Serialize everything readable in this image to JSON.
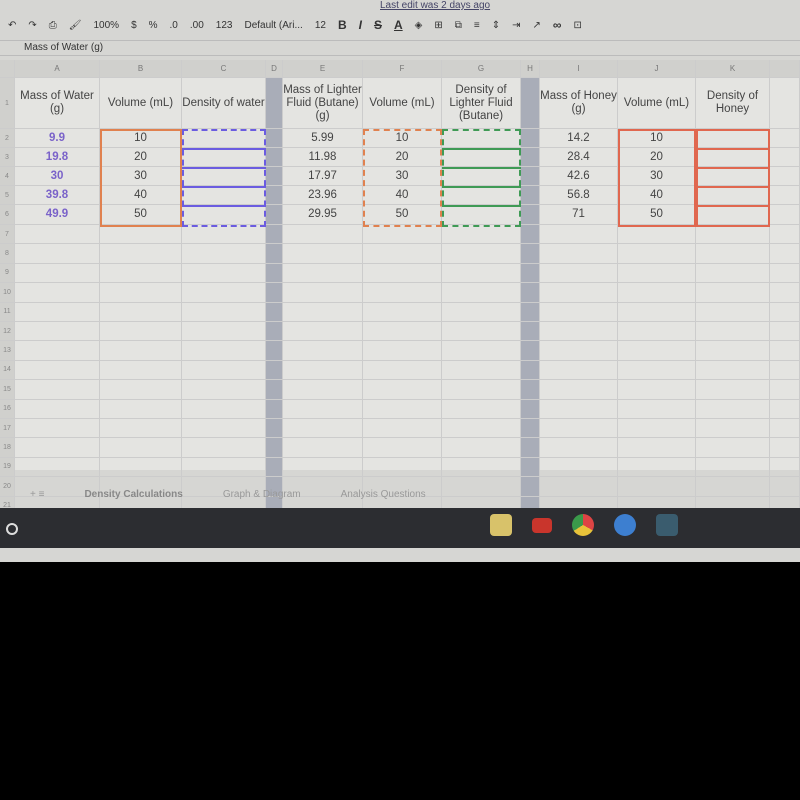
{
  "top_link": "Last edit was 2 days ago",
  "toolbar": {
    "zoom": "100%",
    "currency": "$",
    "percent": "%",
    "dec_less": ".0",
    "dec_more": ".00",
    "format": "123",
    "font": "Default (Ari...",
    "size": "12",
    "bold": "B",
    "italic": "I",
    "strike": "S",
    "text_color": "A",
    "link": "∞"
  },
  "formula_bar": {
    "value": "Mass of Water (g)"
  },
  "columns": [
    "A",
    "B",
    "C",
    "D",
    "E",
    "F",
    "G",
    "H",
    "I",
    "J",
    "K"
  ],
  "headers": [
    "Mass of Water (g)",
    "Volume (mL)",
    "Density of water",
    "",
    "Mass of Lighter Fluid (Butane) (g)",
    "Volume (mL)",
    "Density of Lighter Fluid (Butane)",
    "",
    "Mass of Honey (g)",
    "Volume (mL)",
    "Density of Honey"
  ],
  "rows": [
    [
      "9.9",
      "10",
      "",
      "",
      "5.99",
      "10",
      "",
      "",
      "14.2",
      "10",
      ""
    ],
    [
      "19.8",
      "20",
      "",
      "",
      "11.98",
      "20",
      "",
      "",
      "28.4",
      "20",
      ""
    ],
    [
      "30",
      "30",
      "",
      "",
      "17.97",
      "30",
      "",
      "",
      "42.6",
      "30",
      ""
    ],
    [
      "39.8",
      "40",
      "",
      "",
      "23.96",
      "40",
      "",
      "",
      "56.8",
      "40",
      ""
    ],
    [
      "49.9",
      "50",
      "",
      "",
      "29.95",
      "50",
      "",
      "",
      "71",
      "50",
      ""
    ]
  ],
  "row_numbers": [
    "1",
    "2",
    "3",
    "4",
    "5",
    "6",
    "7",
    "8",
    "9",
    "10",
    "11",
    "12",
    "13",
    "14",
    "15",
    "16",
    "17",
    "18",
    "19",
    "20",
    "21"
  ],
  "sheet_tabs": [
    "Density Calculations",
    "Graph & Diagram",
    "Analysis Questions"
  ],
  "colors": {
    "water_border": "#6b5ce0",
    "orange_border": "#e0814f",
    "butane_border": "#3f9a55",
    "honey_border": "#e0674f"
  }
}
